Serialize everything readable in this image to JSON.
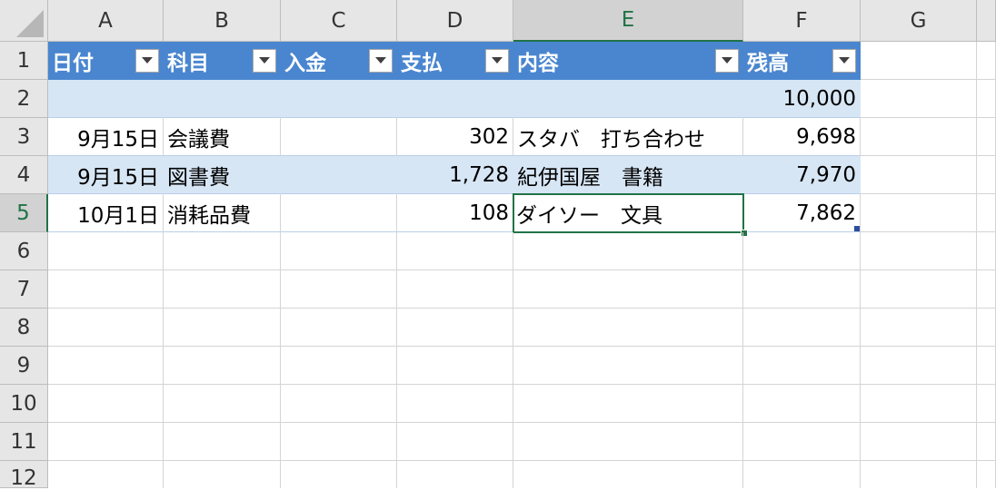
{
  "columns": [
    "A",
    "B",
    "C",
    "D",
    "E",
    "F",
    "G"
  ],
  "rows": [
    "1",
    "2",
    "3",
    "4",
    "5",
    "6",
    "7",
    "8",
    "9",
    "10",
    "11",
    "12"
  ],
  "active": {
    "column": "E",
    "row": "5"
  },
  "table": {
    "headers": [
      "日付",
      "科目",
      "入金",
      "支払",
      "内容",
      "残高"
    ],
    "rows": [
      [
        "",
        "",
        "",
        "",
        "",
        "10,000"
      ],
      [
        "9月15日",
        "会議費",
        "",
        "302",
        "スタバ　打ち合わせ",
        "9,698"
      ],
      [
        "9月15日",
        "図書費",
        "",
        "1,728",
        "紀伊国屋　書籍",
        "7,970"
      ],
      [
        "10月1日",
        "消耗品費",
        "",
        "108",
        "ダイソー　文具",
        "7,862"
      ]
    ]
  },
  "colors": {
    "header_bg": "#4a86cf",
    "band": "#d7e6f5",
    "active_green": "#217346"
  }
}
